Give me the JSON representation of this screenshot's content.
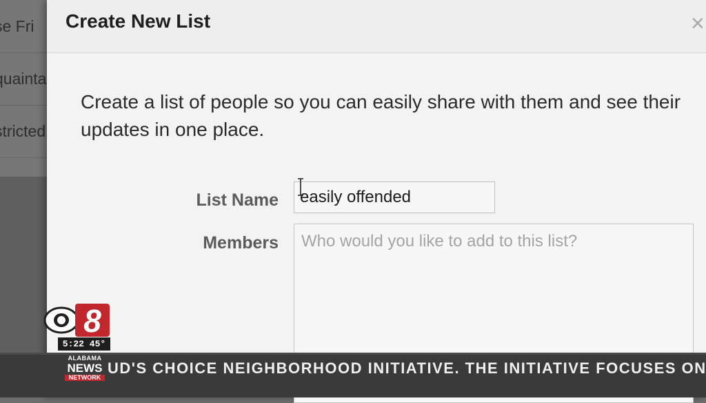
{
  "background_list": {
    "items": [
      "se Fri",
      "quainta",
      "stricted"
    ]
  },
  "dialog": {
    "title": "Create New List",
    "close_icon": "×",
    "intro": "Create a list of people so you can easily share with them and see their updates in one place.",
    "list_name_label": "List Name",
    "list_name_value": "easily offended",
    "members_label": "Members",
    "members_placeholder": "Who would you like to add to this list?"
  },
  "overlay": {
    "network_line1": "ALABAMA",
    "network_line2": "NEWS",
    "network_line3": "NETWORK",
    "ticker_text": "UD'S CHOICE NEIGHBORHOOD INITIATIVE. THE INITIATIVE FOCUSES ON",
    "station_number": "8",
    "clock": "5:22 45°"
  },
  "colors": {
    "dialog_bg": "#f3f3f3",
    "label_gray": "#5b5b5b",
    "station_red": "#c1272d"
  }
}
